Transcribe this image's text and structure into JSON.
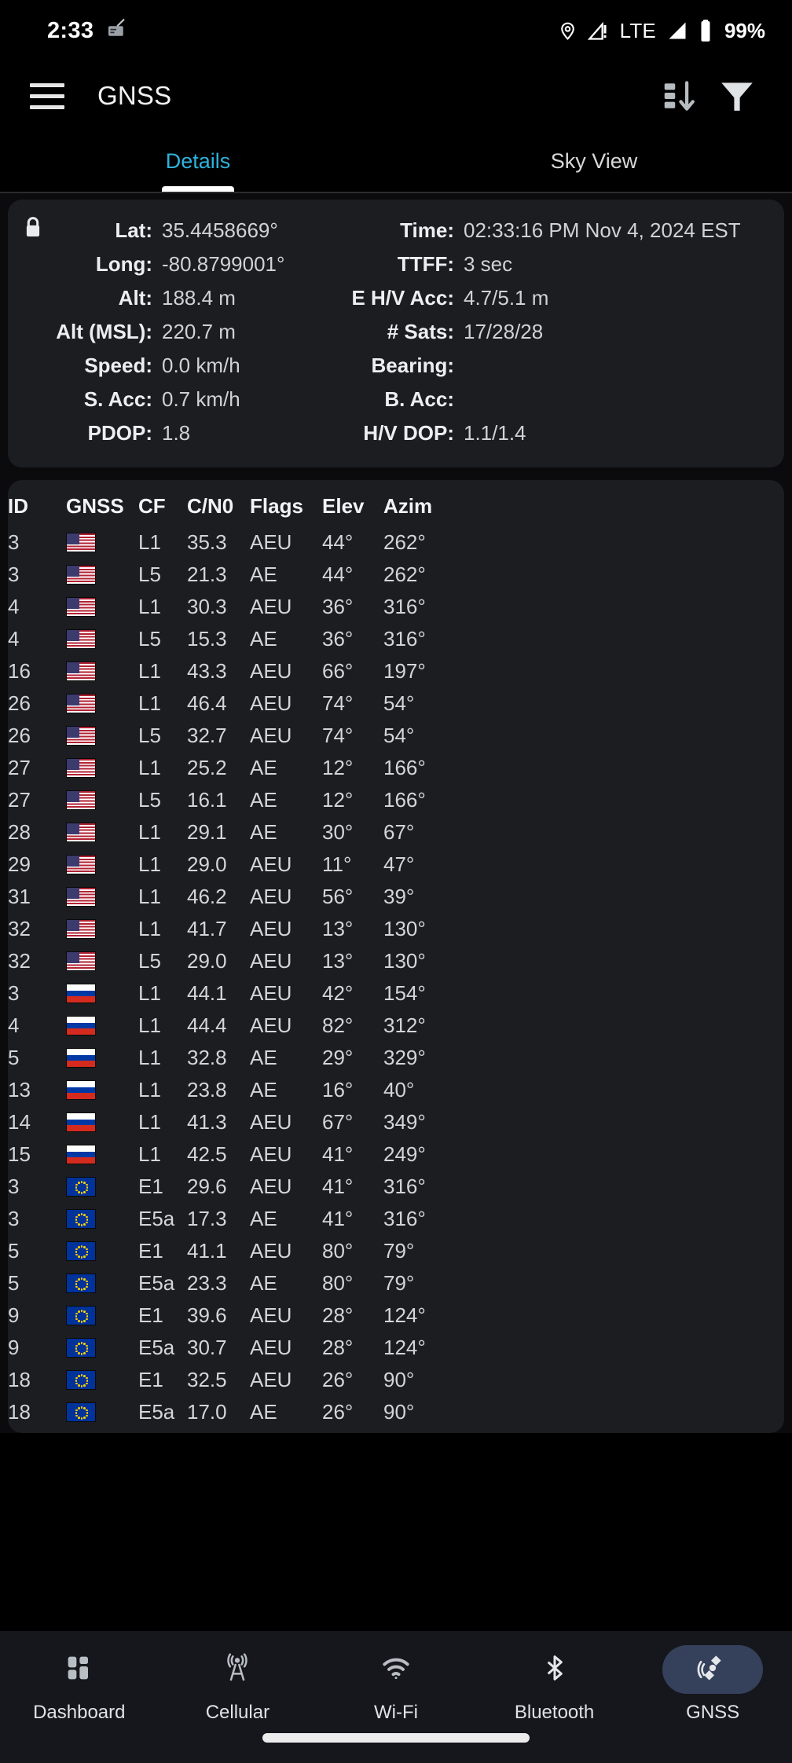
{
  "status_bar": {
    "time": "2:33",
    "alarm_icon": "alarm-clock-icon",
    "location_icon": "location-pin-icon",
    "signal_warning_icon": "cellular-no-data-icon",
    "network": "LTE",
    "signal_icon": "signal-bars-icon",
    "battery_icon": "battery-icon",
    "battery": "99%"
  },
  "app_bar": {
    "menu_icon": "hamburger-menu-icon",
    "title": "GNSS",
    "sort_icon": "sort-descending-icon",
    "filter_icon": "filter-funnel-icon"
  },
  "tabs": {
    "items": [
      {
        "label": "Details",
        "active": true
      },
      {
        "label": "Sky View",
        "active": false
      }
    ]
  },
  "info_card": {
    "lock_icon": "lock-icon",
    "rows": [
      {
        "label_left": "Lat:",
        "value_left": "35.4458669°",
        "label_right": "Time:",
        "value_right": "02:33:16 PM Nov 4, 2024 EST"
      },
      {
        "label_left": "Long:",
        "value_left": "-80.8799001°",
        "label_right": "TTFF:",
        "value_right": "3 sec"
      },
      {
        "label_left": "Alt:",
        "value_left": "188.4 m",
        "label_right": "E H/V Acc:",
        "value_right": "4.7/5.1 m"
      },
      {
        "label_left": "Alt (MSL):",
        "value_left": "220.7 m",
        "label_right": "# Sats:",
        "value_right": "17/28/28"
      },
      {
        "label_left": "Speed:",
        "value_left": "0.0 km/h",
        "label_right": "Bearing:",
        "value_right": ""
      },
      {
        "label_left": "S. Acc:",
        "value_left": "0.7 km/h",
        "label_right": "B. Acc:",
        "value_right": ""
      },
      {
        "label_left": "PDOP:",
        "value_left": "1.8",
        "label_right": "H/V DOP:",
        "value_right": "1.1/1.4"
      }
    ]
  },
  "sat_table": {
    "columns": [
      "ID",
      "GNSS",
      "CF",
      "C/N0",
      "Flags",
      "Elev",
      "Azim"
    ],
    "rows": [
      {
        "id": "3",
        "flag": "us",
        "cf": "L1",
        "cn0": "35.3",
        "flags": "AEU",
        "elev": "44°",
        "azim": "262°"
      },
      {
        "id": "3",
        "flag": "us",
        "cf": "L5",
        "cn0": "21.3",
        "flags": "AE",
        "elev": "44°",
        "azim": "262°"
      },
      {
        "id": "4",
        "flag": "us",
        "cf": "L1",
        "cn0": "30.3",
        "flags": "AEU",
        "elev": "36°",
        "azim": "316°"
      },
      {
        "id": "4",
        "flag": "us",
        "cf": "L5",
        "cn0": "15.3",
        "flags": "AE",
        "elev": "36°",
        "azim": "316°"
      },
      {
        "id": "16",
        "flag": "us",
        "cf": "L1",
        "cn0": "43.3",
        "flags": "AEU",
        "elev": "66°",
        "azim": "197°"
      },
      {
        "id": "26",
        "flag": "us",
        "cf": "L1",
        "cn0": "46.4",
        "flags": "AEU",
        "elev": "74°",
        "azim": "54°"
      },
      {
        "id": "26",
        "flag": "us",
        "cf": "L5",
        "cn0": "32.7",
        "flags": "AEU",
        "elev": "74°",
        "azim": "54°"
      },
      {
        "id": "27",
        "flag": "us",
        "cf": "L1",
        "cn0": "25.2",
        "flags": "AE",
        "elev": "12°",
        "azim": "166°"
      },
      {
        "id": "27",
        "flag": "us",
        "cf": "L5",
        "cn0": "16.1",
        "flags": "AE",
        "elev": "12°",
        "azim": "166°"
      },
      {
        "id": "28",
        "flag": "us",
        "cf": "L1",
        "cn0": "29.1",
        "flags": "AE",
        "elev": "30°",
        "azim": "67°"
      },
      {
        "id": "29",
        "flag": "us",
        "cf": "L1",
        "cn0": "29.0",
        "flags": "AEU",
        "elev": "11°",
        "azim": "47°"
      },
      {
        "id": "31",
        "flag": "us",
        "cf": "L1",
        "cn0": "46.2",
        "flags": "AEU",
        "elev": "56°",
        "azim": "39°"
      },
      {
        "id": "32",
        "flag": "us",
        "cf": "L1",
        "cn0": "41.7",
        "flags": "AEU",
        "elev": "13°",
        "azim": "130°"
      },
      {
        "id": "32",
        "flag": "us",
        "cf": "L5",
        "cn0": "29.0",
        "flags": "AEU",
        "elev": "13°",
        "azim": "130°"
      },
      {
        "id": "3",
        "flag": "ru",
        "cf": "L1",
        "cn0": "44.1",
        "flags": "AEU",
        "elev": "42°",
        "azim": "154°"
      },
      {
        "id": "4",
        "flag": "ru",
        "cf": "L1",
        "cn0": "44.4",
        "flags": "AEU",
        "elev": "82°",
        "azim": "312°"
      },
      {
        "id": "5",
        "flag": "ru",
        "cf": "L1",
        "cn0": "32.8",
        "flags": "AE",
        "elev": "29°",
        "azim": "329°"
      },
      {
        "id": "13",
        "flag": "ru",
        "cf": "L1",
        "cn0": "23.8",
        "flags": "AE",
        "elev": "16°",
        "azim": "40°"
      },
      {
        "id": "14",
        "flag": "ru",
        "cf": "L1",
        "cn0": "41.3",
        "flags": "AEU",
        "elev": "67°",
        "azim": "349°"
      },
      {
        "id": "15",
        "flag": "ru",
        "cf": "L1",
        "cn0": "42.5",
        "flags": "AEU",
        "elev": "41°",
        "azim": "249°"
      },
      {
        "id": "3",
        "flag": "eu",
        "cf": "E1",
        "cn0": "29.6",
        "flags": "AEU",
        "elev": "41°",
        "azim": "316°"
      },
      {
        "id": "3",
        "flag": "eu",
        "cf": "E5a",
        "cn0": "17.3",
        "flags": "AE",
        "elev": "41°",
        "azim": "316°"
      },
      {
        "id": "5",
        "flag": "eu",
        "cf": "E1",
        "cn0": "41.1",
        "flags": "AEU",
        "elev": "80°",
        "azim": "79°"
      },
      {
        "id": "5",
        "flag": "eu",
        "cf": "E5a",
        "cn0": "23.3",
        "flags": "AE",
        "elev": "80°",
        "azim": "79°"
      },
      {
        "id": "9",
        "flag": "eu",
        "cf": "E1",
        "cn0": "39.6",
        "flags": "AEU",
        "elev": "28°",
        "azim": "124°"
      },
      {
        "id": "9",
        "flag": "eu",
        "cf": "E5a",
        "cn0": "30.7",
        "flags": "AEU",
        "elev": "28°",
        "azim": "124°"
      },
      {
        "id": "18",
        "flag": "eu",
        "cf": "E1",
        "cn0": "32.5",
        "flags": "AEU",
        "elev": "26°",
        "azim": "90°"
      },
      {
        "id": "18",
        "flag": "eu",
        "cf": "E5a",
        "cn0": "17.0",
        "flags": "AE",
        "elev": "26°",
        "azim": "90°"
      }
    ]
  },
  "bottom_nav": {
    "items": [
      {
        "label": "Dashboard",
        "icon": "dashboard-grid-icon",
        "active": false
      },
      {
        "label": "Cellular",
        "icon": "cell-tower-icon",
        "active": false
      },
      {
        "label": "Wi-Fi",
        "icon": "wifi-icon",
        "active": false
      },
      {
        "label": "Bluetooth",
        "icon": "bluetooth-icon",
        "active": false
      },
      {
        "label": "GNSS",
        "icon": "satellite-icon",
        "active": true
      }
    ]
  },
  "colors": {
    "accent": "#2eb3dc",
    "card_bg": "#1b1d21",
    "nav_bg": "#15171c",
    "nav_pill": "#35405a"
  }
}
